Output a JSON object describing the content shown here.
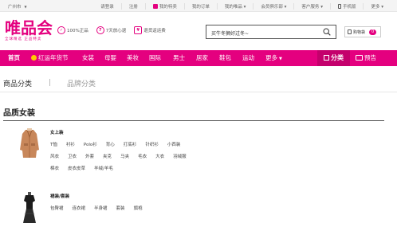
{
  "topbar": {
    "location": "广州市",
    "links": [
      "请登录",
      "注册",
      "我的特卖",
      "我的订单",
      "我的唯品",
      "会员俱乐部",
      "客户服务",
      "手机版",
      "更多"
    ]
  },
  "header": {
    "logo": "唯品会",
    "slogan": "全球精选 正品特卖",
    "badges": [
      {
        "icon": "shield-check-icon",
        "glyph": "✓",
        "label": "100%正品"
      },
      {
        "icon": "seven-day-return-icon",
        "glyph": "7",
        "label": "7天放心退"
      },
      {
        "icon": "refund-icon",
        "glyph": "¥",
        "label": "退货返运费"
      }
    ],
    "search_placeholder": "买牛冬狮好过冬~",
    "cart_label": "购物袋",
    "cart_count": "0"
  },
  "nav": {
    "items": [
      "首页",
      "红运年货节",
      "女装",
      "母婴",
      "美妆",
      "国际",
      "男士",
      "居家",
      "鞋包",
      "运动",
      "更多"
    ],
    "category_label": "分类",
    "preview_label": "预告",
    "accent": "#e4007f"
  },
  "tabs": {
    "active": "商品分类",
    "inactive": "品牌分类"
  },
  "section": {
    "title": "品质女装",
    "categories": [
      {
        "title": "女上装",
        "rows": [
          [
            "T恤",
            "衬衫",
            "Polo衫",
            "背心",
            "打底衫",
            "针织衫",
            "小西装"
          ],
          [
            "风衣",
            "卫衣",
            "外套",
            "夹克",
            "马夹",
            "毛衣",
            "大衣",
            "羽绒服"
          ],
          [
            "棉衣",
            "皮衣皮草",
            "羊绒/羊毛"
          ]
        ]
      },
      {
        "title": "裙装/套装",
        "rows": [
          [
            "包臀裙",
            "连衣裙",
            "半身裙",
            "套装",
            "旗袍"
          ]
        ]
      }
    ]
  }
}
